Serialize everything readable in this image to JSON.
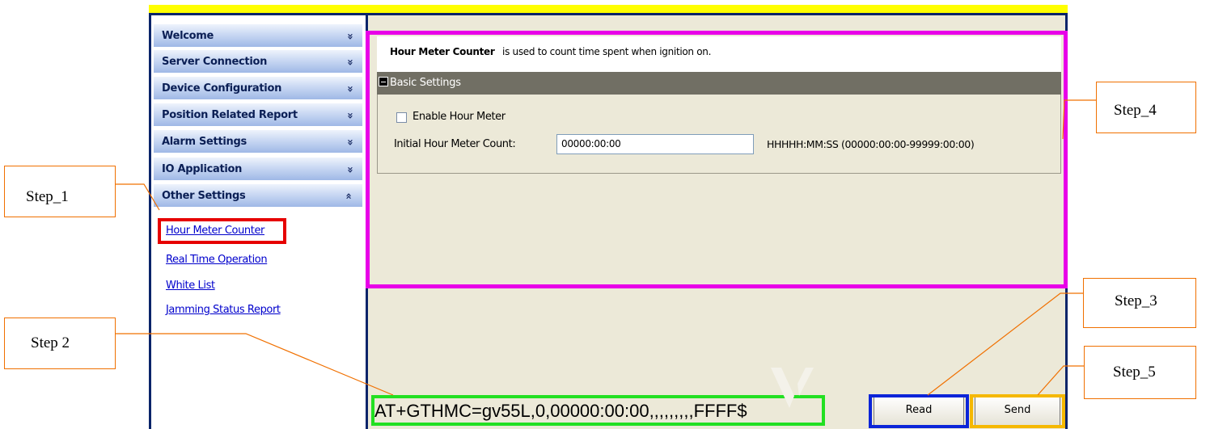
{
  "sidebar": {
    "items": [
      {
        "label": "Welcome",
        "chevron": "double-down"
      },
      {
        "label": "Server Connection",
        "chevron": "double-down"
      },
      {
        "label": "Device Configuration",
        "chevron": "double-down"
      },
      {
        "label": "Position Related Report",
        "chevron": "double-down"
      },
      {
        "label": "Alarm Settings",
        "chevron": "double-down"
      },
      {
        "label": "IO Application",
        "chevron": "double-down"
      },
      {
        "label": "Other Settings",
        "chevron": "double-up"
      }
    ],
    "chevron_down": "»",
    "chevron_up": "«",
    "sub_items": [
      {
        "label": "Hour Meter Counter",
        "active": true
      },
      {
        "label": "Real Time Operation"
      },
      {
        "label": "White List"
      },
      {
        "label": "Jamming Status Report"
      }
    ]
  },
  "main": {
    "description_title": "Hour Meter Counter",
    "description_text": "is used to count time spent when ignition on.",
    "section_title": "Basic Settings",
    "enable_label": "Enable Hour Meter",
    "enable_checked": false,
    "initial_count_label": "Initial Hour Meter Count:",
    "initial_count_value": "00000:00:00",
    "format_hint": "HHHHH:MM:SS (00000:00:00-99999:00:00)"
  },
  "command": {
    "text": "AT+GTHMC=gv55L,0,00000:00:00,,,,,,,,,FFFF$"
  },
  "buttons": {
    "read_label": "Read",
    "send_label": "Send"
  },
  "annotations": {
    "step1": "Step_1",
    "step2": "Step  2",
    "step3": "Step_3",
    "step4": "Step_4",
    "step5": "Step_5"
  },
  "colors": {
    "highlight_menu": "#e60000",
    "highlight_command": "#22e022",
    "highlight_read": "#0b24d8",
    "highlight_send": "#f5b800",
    "highlight_panel": "#e800e8",
    "callout_border": "#f07000",
    "title_bar": "#ffff00"
  }
}
